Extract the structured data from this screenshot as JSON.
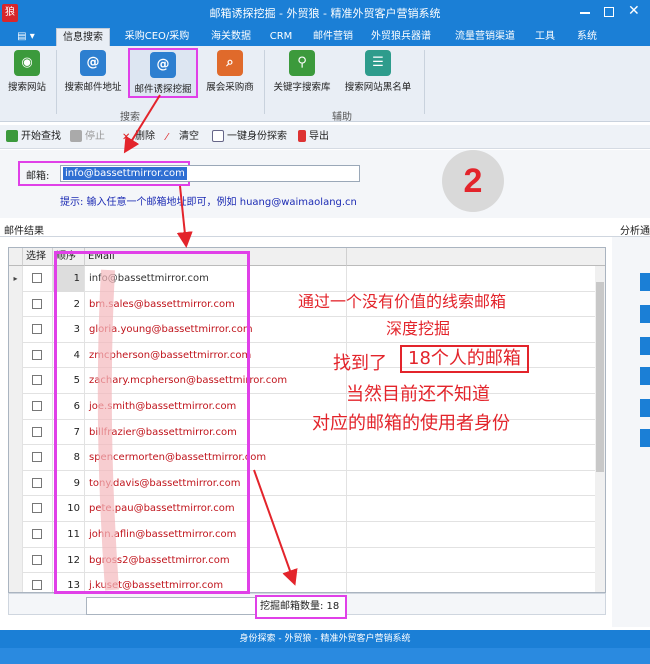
{
  "window": {
    "title": "邮箱诱探挖掘 - 外贸狼 - 精准外贸客户营销系统",
    "logo_text": "狼"
  },
  "menu": [
    "信息搜索",
    "采购CEO/采购",
    "海关数据",
    "CRM",
    "邮件营销",
    "外贸狼兵器谱",
    "流量营销渠道",
    "工具",
    "系统"
  ],
  "ribbon": {
    "buttons": [
      {
        "label": "搜索网站",
        "icon": "globe-icon",
        "color": "#3c9a3c"
      },
      {
        "label": "搜索邮件地址",
        "icon": "at-icon",
        "color": "#2d7fd0"
      },
      {
        "label": "邮件诱探挖掘",
        "icon": "at-magnify-icon",
        "color": "#2d7fd0"
      },
      {
        "label": "展会采购商",
        "icon": "magnify-icon",
        "color": "#e06a2b"
      },
      {
        "label": "关键字搜索库",
        "icon": "keyword-icon",
        "color": "#3c9a3c"
      },
      {
        "label": "搜索网站黑名单",
        "icon": "blacklist-icon",
        "color": "#2e9c8c"
      }
    ],
    "group_search": "搜索",
    "group_assist": "辅助"
  },
  "toolbar": {
    "start": "开始查找",
    "stop": "停止",
    "delete": "删除",
    "clear": "清空",
    "identity": "一键身份探索",
    "export": "导出"
  },
  "search": {
    "email_label": "邮箱:",
    "email_value": "info@bassettmirror.com",
    "tip": "提示: 输入任意一个邮箱地址即可，例如 huang@waimaolang.cn"
  },
  "step_number": "2",
  "results": {
    "title": "邮件结果",
    "right_tab": "分析通",
    "headers": {
      "select": "选择",
      "order": "顺序",
      "email": "EMail"
    },
    "rows": [
      {
        "n": "1",
        "email": "info@bassettmirror.com"
      },
      {
        "n": "2",
        "email": "bm.sales@bassettmirror.com"
      },
      {
        "n": "3",
        "email": "gloria.young@bassettmirror.com"
      },
      {
        "n": "4",
        "email": "zmcpherson@bassettmirror.com"
      },
      {
        "n": "5",
        "email": "zachary.mcpherson@bassettmirror.com"
      },
      {
        "n": "6",
        "email": "joe.smith@bassettmirror.com"
      },
      {
        "n": "7",
        "email": "billfrazier@bassettmirror.com"
      },
      {
        "n": "8",
        "email": "spencermorten@bassettmirror.com"
      },
      {
        "n": "9",
        "email": "tony.davis@bassettmirror.com"
      },
      {
        "n": "10",
        "email": "pete.pau@bassettmirror.com"
      },
      {
        "n": "11",
        "email": "john.aflin@bassettmirror.com"
      },
      {
        "n": "12",
        "email": "bgross2@bassettmirror.com"
      },
      {
        "n": "13",
        "email": "j.kuset@bassettmirror.com"
      }
    ],
    "count_label": "挖掘邮箱数量: 18"
  },
  "annotations": [
    "通过一个没有价值的线索邮箱",
    "深度挖掘",
    "找到了",
    "18个人的邮箱",
    "当然目前还不知道",
    "对应的邮箱的使用者身份"
  ],
  "footer_title": "身份探索 - 外贸狼 - 精准外贸客户营销系统",
  "colors": {
    "accent": "#1b7fd6",
    "highlight": "#e040e8",
    "annotation": "#e3242b"
  }
}
